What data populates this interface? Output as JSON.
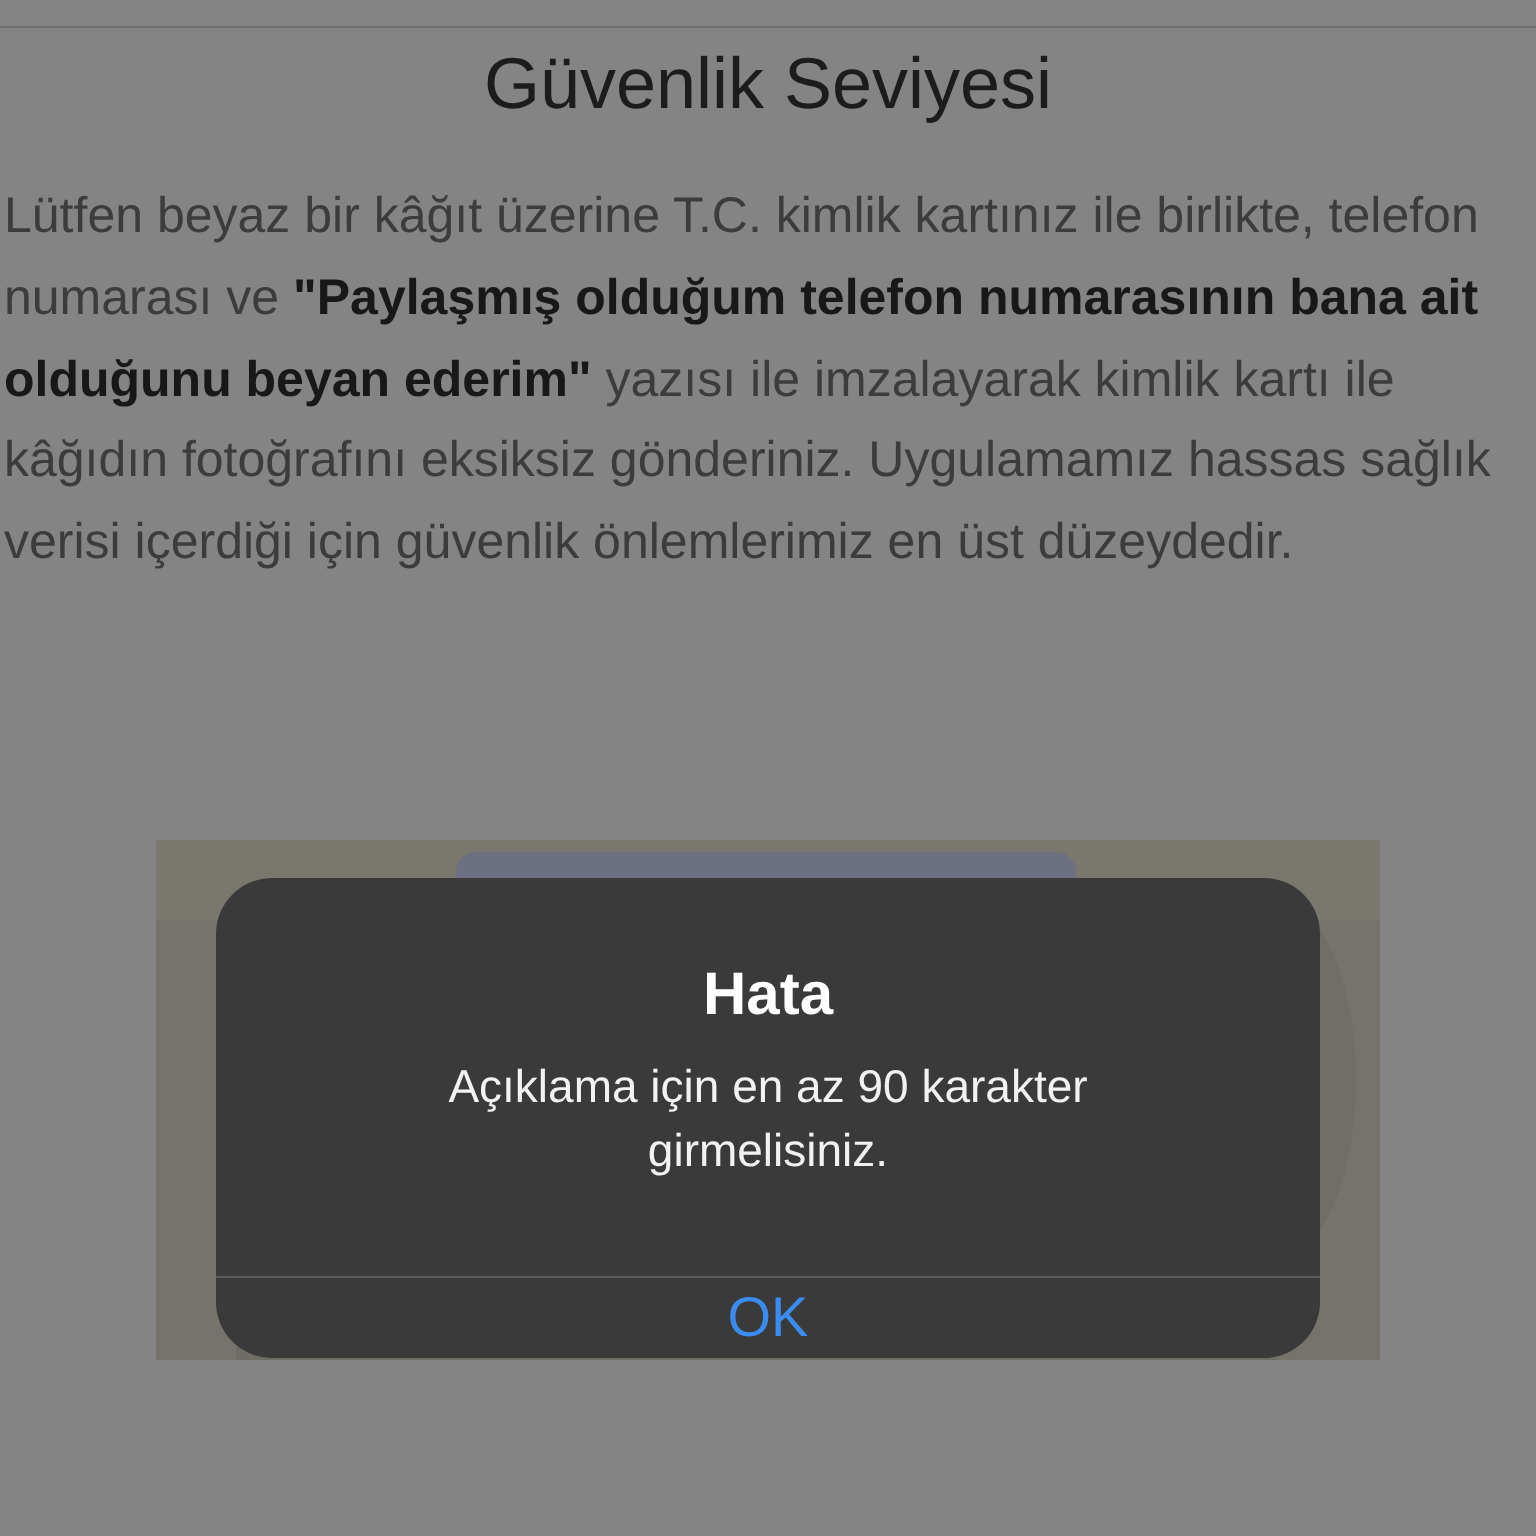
{
  "page": {
    "title": "Güvenlik Seviyesi",
    "instructions": "Lütfen beyaz bir kâğıt üzerine T.C. kimlik kartınız ile birlikte, telefon numarası ve  **\"Paylaşmış olduğum telefon numarasının bana ait olduğunu beyan ederim\"** yazısı ile imzalayarak kimlik kartı ile kâğıdın fotoğrafını eksiksiz gönderiniz.  Uygulamamız hassas sağlık verisi içerdiği için güvenlik önlemlerimiz en üst düzeydedir."
  },
  "alert": {
    "title": "Hata",
    "message": "Açıklama için en az 90 karakter girmelisiniz.",
    "buttons": [
      "OK"
    ]
  }
}
